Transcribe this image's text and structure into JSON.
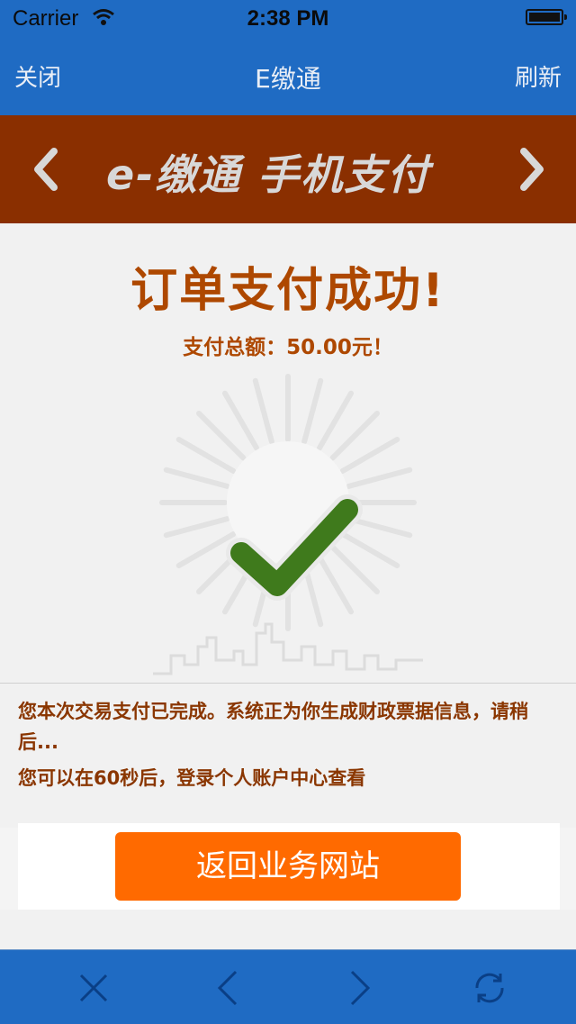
{
  "status_bar": {
    "carrier": "Carrier",
    "time": "2:38 PM"
  },
  "nav_bar": {
    "close_label": "关闭",
    "title": "E缴通",
    "refresh_label": "刷新"
  },
  "banner": {
    "brand_text": "e-缴通 手机支付"
  },
  "result": {
    "headline": "订单支付成功!",
    "amount_text": "支付总额：50.00元！"
  },
  "messages": {
    "line1": "您本次交易支付已完成。系统正为你生成财政票据信息，请稍后...",
    "line2": "您可以在60秒后，登录个人账户中心查看"
  },
  "actions": {
    "return_label": "返回业务网站"
  },
  "toolbar": {
    "icons": [
      "close-icon",
      "back-icon",
      "forward-icon",
      "reload-icon"
    ]
  },
  "colors": {
    "nav_blue": "#1f6bc3",
    "banner_brown": "#8a2f00",
    "accent_orange": "#ff6a00",
    "text_orange": "#ae4800",
    "check_green": "#3f7a1c"
  }
}
